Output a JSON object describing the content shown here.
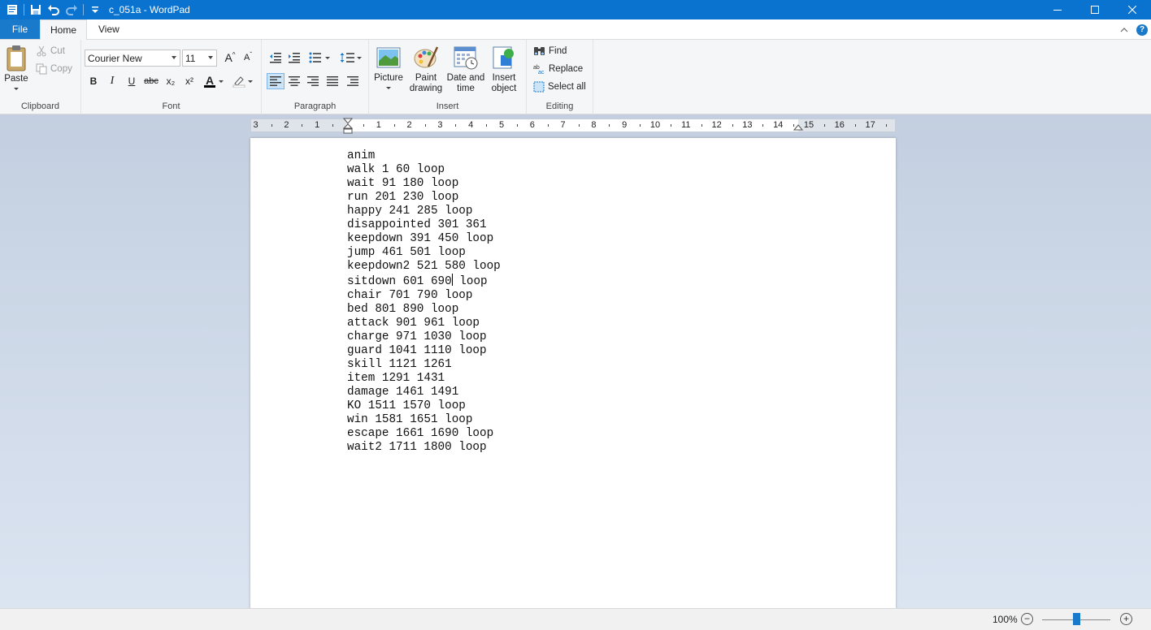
{
  "window": {
    "title": "c_051a - WordPad"
  },
  "menu": {
    "file": "File",
    "home": "Home",
    "view": "View"
  },
  "clipboard": {
    "group": "Clipboard",
    "paste": "Paste",
    "cut": "Cut",
    "copy": "Copy"
  },
  "font": {
    "group": "Font",
    "family": "Courier New",
    "size": "11",
    "bold": "B",
    "italic": "I",
    "underline": "U",
    "strike": "abc",
    "subscript": "x₂",
    "superscript": "x²",
    "color_letter": "A"
  },
  "paragraph": {
    "group": "Paragraph"
  },
  "insert": {
    "group": "Insert",
    "picture": "Picture",
    "paint_l1": "Paint",
    "paint_l2": "drawing",
    "datetime_l1": "Date and",
    "datetime_l2": "time",
    "object_l1": "Insert",
    "object_l2": "object"
  },
  "editing": {
    "group": "Editing",
    "find": "Find",
    "replace": "Replace",
    "select_all": "Select all"
  },
  "ruler": {
    "labels": [
      "3",
      "2",
      "1",
      "1",
      "2",
      "3",
      "4",
      "5",
      "6",
      "7",
      "8",
      "9",
      "10",
      "11",
      "12",
      "13",
      "14",
      "15",
      "16",
      "17"
    ]
  },
  "document": {
    "lines": [
      "anim",
      "walk 1 60 loop",
      "wait 91 180 loop",
      "run 201 230 loop",
      "happy 241 285 loop",
      "disappointed 301 361",
      "keepdown 391 450 loop",
      "jump 461 501 loop",
      "keepdown2 521 580 loop",
      "sitdown 601 690 loop",
      "chair 701 790 loop",
      "bed 801 890 loop",
      "attack 901 961 loop",
      "charge 971 1030 loop",
      "guard 1041 1110 loop",
      "skill 1121 1261",
      "item 1291 1431",
      "damage 1461 1491",
      "KO 1511 1570 loop",
      "win 1581 1651 loop",
      "escape 1661 1690 loop",
      "wait2 1711 1800 loop"
    ],
    "caret_line": 9,
    "caret_after": "sitdown 601 690"
  },
  "status": {
    "zoom": "100%",
    "zoom_out": "−",
    "zoom_in": "+",
    "zoom_level": 0.5
  },
  "colors": {
    "titlebar": "#0a73d0",
    "file_tab": "#1979ca",
    "accent": "#1979ca"
  }
}
